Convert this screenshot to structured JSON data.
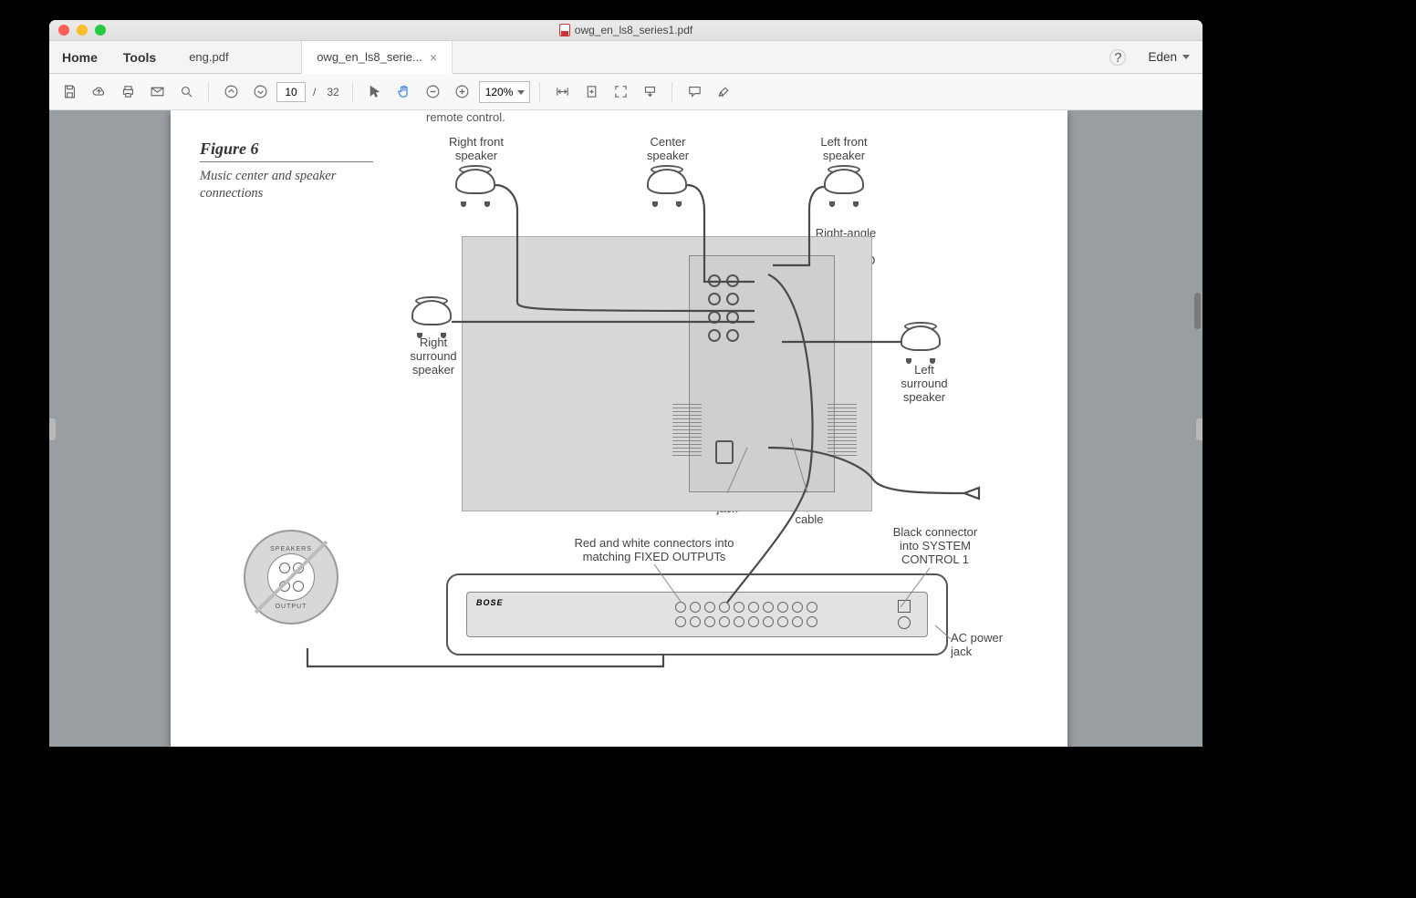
{
  "titlebar": {
    "filename": "owg_en_ls8_series1.pdf"
  },
  "menu": {
    "home": "Home",
    "tools": "Tools"
  },
  "tabs": [
    {
      "label": "eng.pdf",
      "active": false,
      "closable": false
    },
    {
      "label": "owg_en_ls8_serie...",
      "active": true,
      "closable": true
    }
  ],
  "toolbar": {
    "page_current": "10",
    "page_total": "32",
    "page_sep": "/",
    "zoom": "120%"
  },
  "user": {
    "name": "Eden"
  },
  "doc": {
    "top_clip": "remote control.",
    "figure_label": "Figure 6",
    "figure_caption": "Music center and speaker connections",
    "labels": {
      "right_front": "Right front\nspeaker",
      "center": "Center\nspeaker",
      "left_front": "Left front\nspeaker",
      "right_angle": "Right-angle\nconnector\ninto AUDIO\nINPUT",
      "right_surround": "Right\nsurround\nspeaker",
      "left_surround": "Left\nsurround\nspeaker",
      "ac_jack_top": "AC power\njack",
      "audio_cable": "Audio\ninput\ncable",
      "red_white": "Red and white connectors into\nmatching FIXED OUTPUTs",
      "black_connector": "Black connector\ninto SYSTEM\nCONTROL 1",
      "ac_jack_bottom": "AC power\njack",
      "donut_label_top": "SPEAKERS",
      "donut_label_bottom": "OUTPUT"
    }
  }
}
